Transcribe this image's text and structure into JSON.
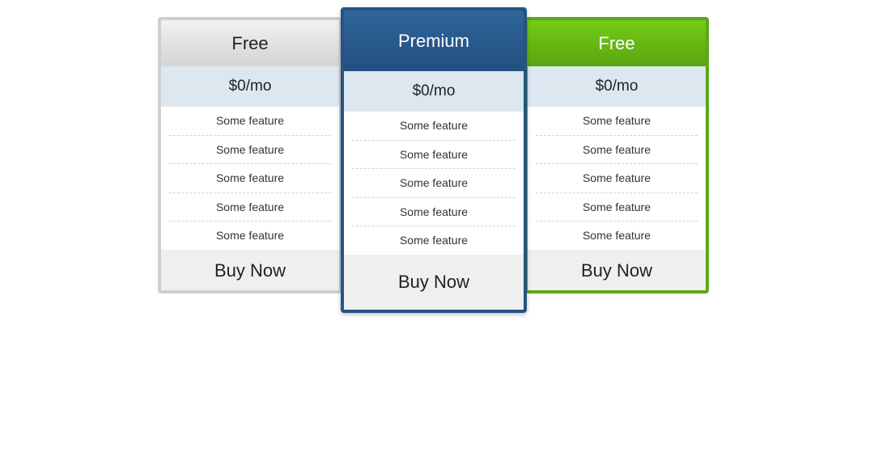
{
  "plans": [
    {
      "name": "Free",
      "price": "$0/mo",
      "features": [
        "Some feature",
        "Some feature",
        "Some feature",
        "Some feature",
        "Some feature"
      ],
      "cta": "Buy Now",
      "accent": "#cfcfcf"
    },
    {
      "name": "Premium",
      "price": "$0/mo",
      "features": [
        "Some feature",
        "Some feature",
        "Some feature",
        "Some feature",
        "Some feature"
      ],
      "cta": "Buy Now",
      "accent": "#265383",
      "featured": true
    },
    {
      "name": "Free",
      "price": "$0/mo",
      "features": [
        "Some feature",
        "Some feature",
        "Some feature",
        "Some feature",
        "Some feature"
      ],
      "cta": "Buy Now",
      "accent": "#5ca71c"
    }
  ]
}
